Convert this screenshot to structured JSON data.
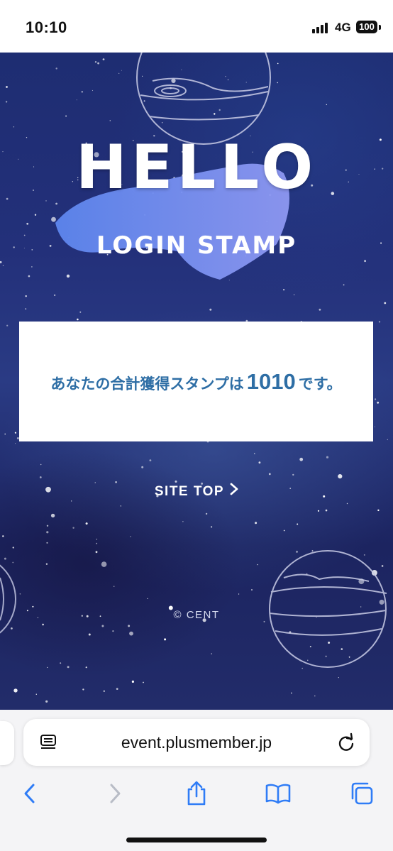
{
  "status_bar": {
    "time": "10:10",
    "network": "4G",
    "battery": "100"
  },
  "page": {
    "title": "HELLO",
    "subtitle": "LOGIN STAMP",
    "stamp_message_prefix": "あなたの合計獲得スタンプは",
    "stamp_count": "1010",
    "stamp_message_suffix": "です。",
    "site_top_label": "SITE TOP",
    "copyright": "© CENT"
  },
  "browser": {
    "url": "event.plusmember.jp",
    "toolbar_icons": [
      "back-icon",
      "forward-icon",
      "share-icon",
      "bookmarks-icon",
      "tabs-icon"
    ]
  },
  "colors": {
    "stamp_text": "#2e6ea5",
    "brush": "#5b7ee8",
    "ios_blue": "#2f7cf6"
  }
}
